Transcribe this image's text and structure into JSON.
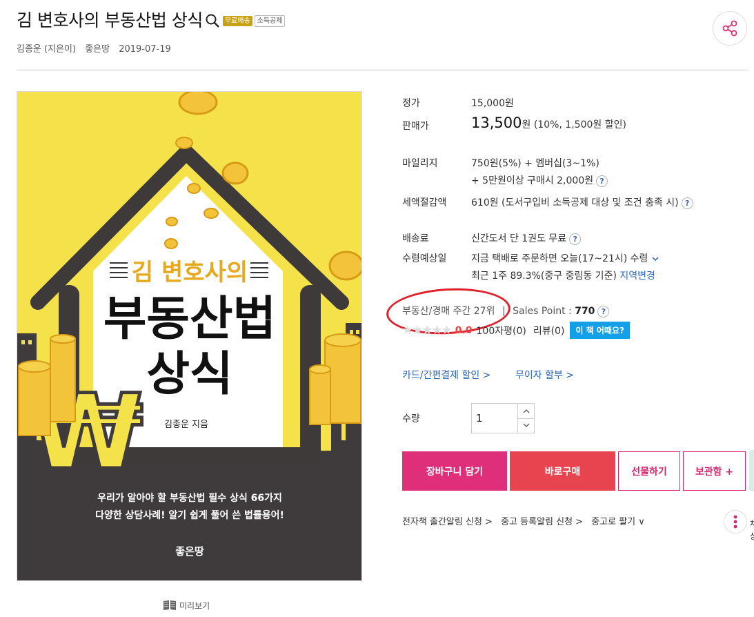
{
  "header": {
    "title": "김 변호사의 부동산법 상식",
    "badge_free": "무료배송",
    "badge_tax": "소득공제",
    "author": "김종운 (지은이)",
    "publisher": "좋은땅",
    "date": "2019-07-19"
  },
  "cover": {
    "title_line1": "김 변호사의",
    "title_line2": "부동산법",
    "title_line3": "상식",
    "author_line": "김종운 지음",
    "desc_line1": "우리가 알아야 할 부동산법 필수 상식 66가지",
    "desc_line2": "다양한 상담사례! 알기 쉽게 풀어 쓴 법률용어!",
    "publisher": "좋은땅",
    "won_symbol": "₩",
    "preview_label": "미리보기",
    "colors": {
      "yellow": "#f5e24a",
      "dark": "#3f3a3b",
      "gold": "#f3c33a",
      "roof": "#3e3a39",
      "title_gold": "#e7a91b"
    }
  },
  "price": {
    "list_label": "정가",
    "list_value": "15,000원",
    "sale_label": "판매가",
    "sale_amount": "13,500",
    "sale_unit": "원",
    "sale_discount": "(10%, 1,500원 할인)"
  },
  "mileage": {
    "label": "마일리지",
    "line1": "750원(5%) + 멤버십(3~1%)",
    "line2": "+ 5만원이상 구매시 2,000원"
  },
  "tax": {
    "label": "세액절감액",
    "value": "610원 (도서구입비 소득공제 대상 및 조건 충족 시)"
  },
  "shipping": {
    "fee_label": "배송료",
    "fee_value": "신간도서 단 1권도 무료",
    "eta_label": "수령예상일",
    "eta_value": "지금 택배로 주문하면 오늘(17~21시) 수령",
    "eta_sub": "최근 1주 89.3%(중구 중림동 기준)",
    "region_link": "지역변경"
  },
  "rank": {
    "text": "부동산/경매 주간 27위",
    "sep": "|",
    "sales_label": "Sales Point : ",
    "sales_value": "770"
  },
  "review": {
    "score": "0.0",
    "count_100": "100자평(0)",
    "review_count": "리뷰(0)",
    "button": "이 책 어때요?"
  },
  "payment": {
    "card": "카드/간편결제 할인 >",
    "installment": "무이자 할부 >"
  },
  "quantity": {
    "label": "수량",
    "value": "1"
  },
  "actions": {
    "cart": "장바구니 담기",
    "buy": "바로구매",
    "gift": "선물하기",
    "keep": "보관함 +"
  },
  "links": {
    "ebook": "전자책 출간알림 신청 >",
    "used_alert": "중고 등록알림 신청 >",
    "used_sell": "중고로 팔기 ∨"
  },
  "help_symbol": "?",
  "edge_text": "채 상"
}
